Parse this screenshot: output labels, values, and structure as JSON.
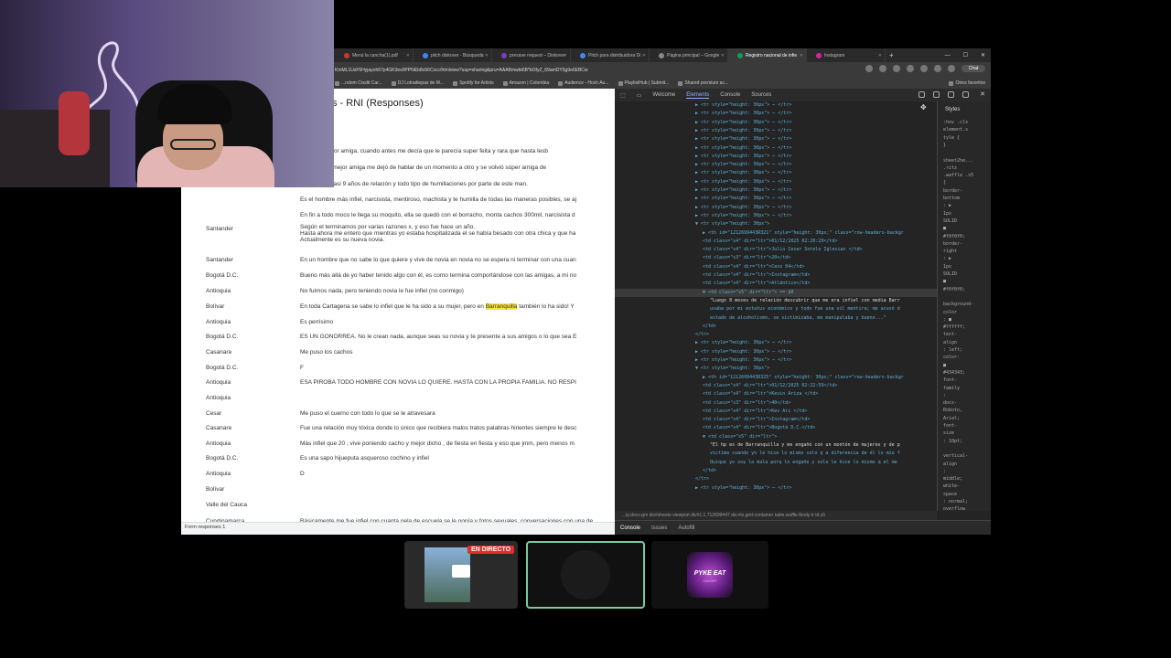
{
  "browser": {
    "tabs": [
      {
        "label": "Menú la cancha(1).pdf"
      },
      {
        "label": "pitch diskover - Búsqueda"
      },
      {
        "label": "presave request – Diskover"
      },
      {
        "label": "Pitch para distribuidora Di"
      },
      {
        "label": "Página principal – Google"
      },
      {
        "label": "Registro nacional de infie"
      },
      {
        "label": "Instagram"
      }
    ],
    "url": "KmML1UsF5Hyjayoh67p4GK3ev0PPNEb8o56Cvcc/htmlview?usp=sharing&pru=AAABmwbt6B*bOfyZ_69amDY5g9e6EBCw",
    "chat_label": "Chat",
    "bookmarks": [
      "...ndom Credit Car...",
      "DJ Lotradiepas de M...",
      "Spotify for Artists",
      "Amazon | Colombia",
      "Audience - Hoch Au...",
      "PlaylistHub | Submit...",
      "Shared premium ac..."
    ],
    "other_favorites": "Otros favoritos"
  },
  "sheet": {
    "title": "s - RNI (Responses)",
    "rows": [
      {
        "region": "",
        "text": "on mi ex mejor amiga, cuando antes me decía que le parecía super feita y rara que hasta lesb"
      },
      {
        "region": "",
        "text": "da de mi ex mejor amiga me dejó de hablar de un momento a otro y se volvió súper amiga de"
      },
      {
        "region": "",
        "text": "o todos los casi 9 años de relación y todo tipo de humillaciones por parte de este man."
      },
      {
        "region": "",
        "text": "Es el hombre más infiel, narcisista, mentiroso, machista y te humilla de todas las maneras posibles, se aj"
      },
      {
        "region": "",
        "text": "En fin a todo moco le llega su moquito, ella se quedó con el borracho, monta cachos 300mil, narcisista d"
      },
      {
        "region": "Santander",
        "text": "Según el terminamos por varias razones x, y eso fue hace un año.\nHasta ahora me entero que mientras yo estaba hospitalizada el se había besado con otra chica y que ha\nActualmente es su nueva novia."
      },
      {
        "region": "Santander",
        "text": "En un hombre que no sabe lo que quiere y vive de novia en novia no se espera ni terminar con una cuan"
      },
      {
        "region": "Bogotá D.C.",
        "text": "Bueno más allá de yo haber tenido algo con él, es como termina comportándose con las amigas, a mi no"
      },
      {
        "region": "Antioquia",
        "text": "No fuimos nada, pero teniendo novia le fue infiel (no conmigo)"
      },
      {
        "region": "Bolívar",
        "text_before": "En toda Cartagena se sabe lo infiel que le ha sido a su mujer, pero en ",
        "highlight": "Barranquilla",
        "text_after": " también lo ha sido! Y"
      },
      {
        "region": "Antioquia",
        "text": "Es perrisimo"
      },
      {
        "region": "Bogotá D.C.",
        "text": "ES UN GONORREA. No le crean nada, aunque seas su novia y te presente a sus amigos o lo que sea E"
      },
      {
        "region": "Casanare",
        "text": "Me puso los cachos"
      },
      {
        "region": "Bogotá D.C.",
        "text": "F"
      },
      {
        "region": "Antioquia",
        "text": "ESA PIROBA TODO HOMBRE CON NOVIA LO QUIERE. HASTA CON LA PROPIA FAMILIA. NO RESPI"
      },
      {
        "region": "Antioquia",
        "text": ""
      },
      {
        "region": "Cesar",
        "text": "Me puso el cuerno con todo lo que se le atravesara"
      },
      {
        "region": "Casanare",
        "text": "Fue una relación muy tóxica donde lo único que recibiera malos tratos palabras hirientes siempre le desc"
      },
      {
        "region": "Antioquia",
        "text": "Más infiel que 20 , vive poniendo cacho y mejor dicho , de fiesta en fiesta y eso que jmm, pero menos m"
      },
      {
        "region": "Bogotá D.C.",
        "text": "Es una sapo hijueputa asqueroso cochino y infiel"
      },
      {
        "region": "Antioquia",
        "text": "D"
      },
      {
        "region": "Bolívar",
        "text": ""
      },
      {
        "region": "Valle del Cauca",
        "text": ""
      },
      {
        "region": "Cundinamarca",
        "text": "Básicamente me fue infiel con cuanta pela de escuela se le ponía y fotos sexuales, conversaciones con una de"
      }
    ],
    "sheet_tab": "Form responses 1"
  },
  "devtools": {
    "tabs": [
      "Welcome",
      "Elements",
      "Console",
      "Sources"
    ],
    "lines": [
      {
        "indent": 0,
        "text": "▶ <tr style=\"height: 30px\"> ⋯ </tr>"
      },
      {
        "indent": 0,
        "text": "▶ <tr style=\"height: 30px\"> ⋯ </tr>"
      },
      {
        "indent": 0,
        "text": "▶ <tr style=\"height: 30px\"> ⋯ </tr>"
      },
      {
        "indent": 0,
        "text": "▶ <tr style=\"height: 30px\"> ⋯ </tr>"
      },
      {
        "indent": 0,
        "text": "▶ <tr style=\"height: 30px\"> ⋯ </tr>"
      },
      {
        "indent": 0,
        "text": "▶ <tr style=\"height: 30px\"> ⋯ </tr>"
      },
      {
        "indent": 0,
        "text": "▶ <tr style=\"height: 30px\"> ⋯ </tr>"
      },
      {
        "indent": 0,
        "text": "▶ <tr style=\"height: 30px\"> ⋯ </tr>"
      },
      {
        "indent": 0,
        "text": "▶ <tr style=\"height: 30px\"> ⋯ </tr>"
      },
      {
        "indent": 0,
        "text": "▶ <tr style=\"height: 30px\"> ⋯ </tr>"
      },
      {
        "indent": 0,
        "text": "▶ <tr style=\"height: 30px\"> ⋯ </tr>"
      },
      {
        "indent": 0,
        "text": "▶ <tr style=\"height: 30px\"> ⋯ </tr>"
      },
      {
        "indent": 0,
        "text": "▶ <tr style=\"height: 30px\"> ⋯ </tr>"
      },
      {
        "indent": 0,
        "text": "▶ <tr style=\"height: 30px\"> ⋯ </tr>"
      },
      {
        "indent": 0,
        "text": "▼ <tr style=\"height: 30px\">"
      },
      {
        "indent": 1,
        "text": "▶ <th id=\"1212699443R321\" style=\"height: 30px;\" class=\"row-headers-backgr"
      },
      {
        "indent": 1,
        "text": "<td class=\"s4\" dir=\"ltr\">01/12/2025 02:20:20</td>"
      },
      {
        "indent": 1,
        "text": "<td class=\"s4\" dir=\"ltr\">Julio Cesar Sotelo Iglesias </td>"
      },
      {
        "indent": 1,
        "text": "<td class=\"s3\" dir=\"ltr\">20</td>"
      },
      {
        "indent": 1,
        "text": "<td class=\"s4\" dir=\"ltr\">Cess 04</td>"
      },
      {
        "indent": 1,
        "text": "<td class=\"s4\" dir=\"ltr\">Instagram</td>"
      },
      {
        "indent": 1,
        "text": "<td class=\"s4\" dir=\"ltr\">Atlántico</td>"
      },
      {
        "indent": 1,
        "text": "▼ <td class=\"s5\" dir=\"ltr\"> == $0"
      },
      {
        "indent": 2,
        "text": "\"Luego 8 meses de relación descubrir que me era infiel con media Barr"
      },
      {
        "indent": 2,
        "text": "usaba por mi estatus económico y todo fue una vil mentira; me acusó d"
      },
      {
        "indent": 2,
        "text": "estado de alcoholismo, se victimizaba, me manipulaba y bueno...\""
      },
      {
        "indent": 1,
        "text": "</td>"
      },
      {
        "indent": 0,
        "text": "</tr>"
      },
      {
        "indent": 0,
        "text": "▶ <tr style=\"height: 30px\"> ⋯ </tr>"
      },
      {
        "indent": 0,
        "text": "▶ <tr style=\"height: 30px\"> ⋯ </tr>"
      },
      {
        "indent": 0,
        "text": "▶ <tr style=\"height: 30px\"> ⋯ </tr>"
      },
      {
        "indent": 0,
        "text": "▼ <tr style=\"height: 30px\">"
      },
      {
        "indent": 1,
        "text": "▶ <th id=\"1212699443R325\" style=\"height: 30px;\" class=\"row-headers-backgr"
      },
      {
        "indent": 1,
        "text": "<td class=\"s4\" dir=\"ltr\">01/12/2025 02:22:59</td>"
      },
      {
        "indent": 1,
        "text": "<td class=\"s4\" dir=\"ltr\">Kevin Ariza </td>"
      },
      {
        "indent": 1,
        "text": "<td class=\"s3\" dir=\"ltr\">40</td>"
      },
      {
        "indent": 1,
        "text": "<td class=\"s4\" dir=\"ltr\">Kev Ari </td>"
      },
      {
        "indent": 1,
        "text": "<td class=\"s4\" dir=\"ltr\">Instagram</td>"
      },
      {
        "indent": 1,
        "text": "<td class=\"s4\" dir=\"ltr\">Bogotá D.C.</td>"
      },
      {
        "indent": 1,
        "text": "▼ <td class=\"s5\" dir=\"ltr\">"
      },
      {
        "indent": 2,
        "text": "\"El hp es de Barranquilla y me engañó con un montón de mujeres y de p"
      },
      {
        "indent": 2,
        "text": "víctima cuando yo le hice lo mismo solo q a diferencia de él lo mío f"
      },
      {
        "indent": 2,
        "text": "Quique yo soy la mala porq lo engañe y solo le hice lo mismo q el me"
      },
      {
        "indent": 1,
        "text": "</td>"
      },
      {
        "indent": 0,
        "text": "</tr>"
      },
      {
        "indent": 0,
        "text": "▶ <tr style=\"height: 30px\"> ⋯ </tr>"
      }
    ],
    "styles_header": "Styles",
    "styles_lines": [
      ":hov  .cls",
      "element.s",
      "tyle {",
      "}",
      "",
      "sheet2he...",
      ".ritz",
      ".waffle .s5",
      "{",
      "  border-",
      "  bottom",
      "  : ▶",
      "  1px",
      "  SOLID",
      "  ■",
      "  #f0f0f0;",
      "  border-",
      "  right",
      "  : ▶",
      "  1px",
      "  SOLID",
      "  ■",
      "  #f0f0f0;",
      "",
      "  background-",
      "  color",
      "  : ■",
      "  #ffffff;",
      "  text-",
      "  align",
      "  : left;",
      "  color:",
      "  ■",
      "  #434343;",
      "  font-",
      "  family",
      "  :",
      "  docs-",
      "  Roboto,",
      "  Arial;",
      "  font-",
      "  size",
      "  : 10pt;",
      "",
      "  vertical-",
      "  align",
      "  :",
      "  middle;",
      "  white-",
      "  space",
      "  : normal;",
      "  overflow"
    ],
    "breadcrumbs": "...ty.docs-gm   div#sheets-viewport   div#1.1.712699447   div.ritz.grid-container   table.waffle   tbody   tr   td.s5",
    "console_tabs": [
      "Console",
      "Issues",
      "Autofill"
    ]
  },
  "bottom": {
    "live_label": "EN DIRECTO",
    "logo_title": "PYKE EAT",
    "logo_sub": "GAMER"
  },
  "colors": {
    "live": "#e62b2b",
    "highlight": "#f9e23c",
    "selected_border": "#7ec8a0",
    "devtools_bg": "#242424"
  }
}
